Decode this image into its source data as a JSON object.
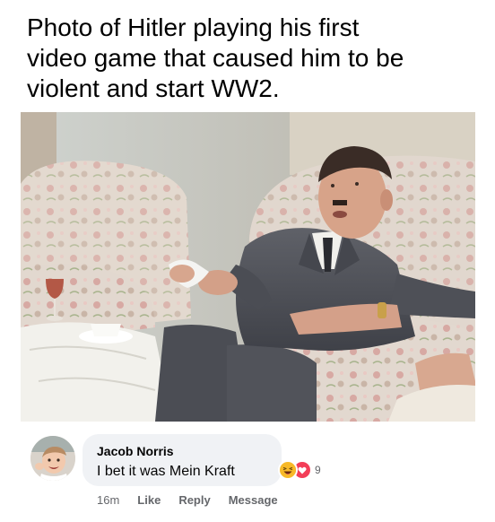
{
  "meme": {
    "caption": "Photo of Hitler playing his first\nvideo game that caused him to be\nviolent and start WW2."
  },
  "comment": {
    "author": "Jacob Norris",
    "text": "I bet it was Mein Kraft",
    "reactions": {
      "icons": [
        "haha-reaction-icon",
        "love-reaction-icon"
      ],
      "count": "9",
      "colors": {
        "haha": "#f7b928",
        "love": "#f33e58"
      }
    },
    "time": "16m",
    "like_label": "Like",
    "reply_label": "Reply",
    "message_label": "Message"
  },
  "colors": {
    "bubble_bg": "#f0f2f5",
    "meta_text": "#65676b",
    "text": "#050505"
  }
}
